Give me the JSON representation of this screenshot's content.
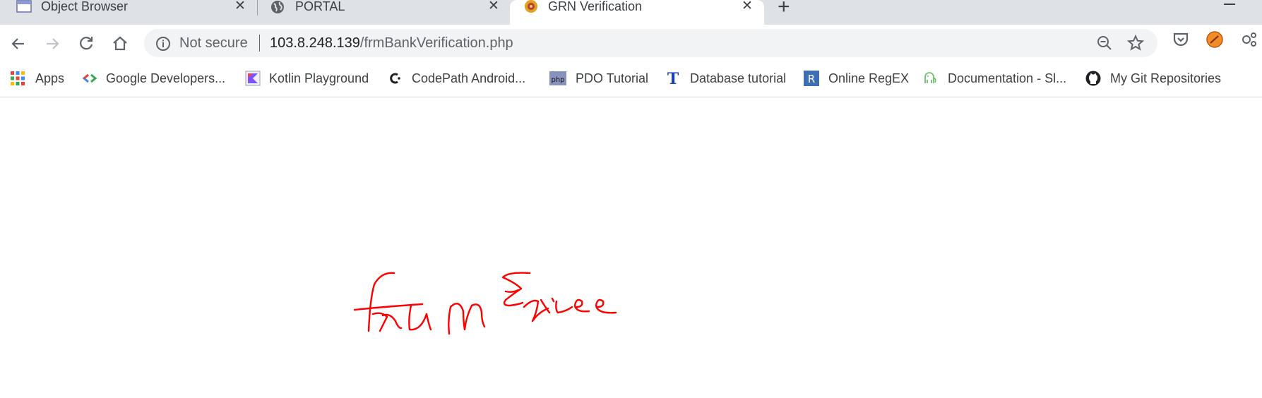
{
  "tabs": [
    {
      "title": "Object Browser",
      "icon": "window-icon",
      "active": false
    },
    {
      "title": "PORTAL",
      "icon": "globe-icon",
      "active": false
    },
    {
      "title": "GRN Verification",
      "icon": "emblem-icon",
      "active": true
    }
  ],
  "omnibox": {
    "security_label": "Not secure",
    "url_host": "103.8.248.139",
    "url_path": "/frmBankVerification.php"
  },
  "bookmarks": [
    {
      "label": "Apps",
      "icon": "apps-grid-icon"
    },
    {
      "label": "Google Developers...",
      "icon": "google-developers-icon"
    },
    {
      "label": "Kotlin Playground",
      "icon": "kotlin-icon"
    },
    {
      "label": "CodePath Android...",
      "icon": "codepath-icon"
    },
    {
      "label": "PDO Tutorial",
      "icon": "php-icon"
    },
    {
      "label": "Database tutorial",
      "icon": "t-letter-icon"
    },
    {
      "label": "Online RegEX",
      "icon": "r-letter-icon"
    },
    {
      "label": "Documentation - Sl...",
      "icon": "elephant-icon"
    },
    {
      "label": "My Git Repositories",
      "icon": "github-icon"
    }
  ],
  "annotation": {
    "text": "frmEnice",
    "color": "#ff0000"
  },
  "colors": {
    "tabstrip": "#dee1e6",
    "omnibox": "#f1f3f4",
    "text": "#3c4043"
  }
}
